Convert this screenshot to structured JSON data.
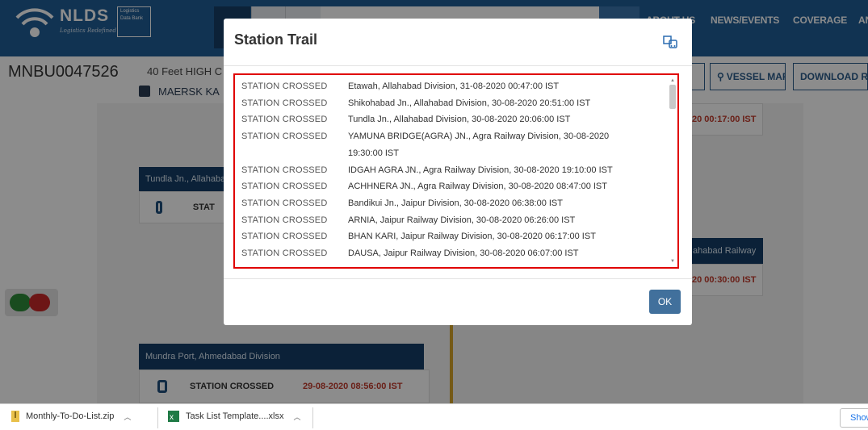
{
  "brand": {
    "name": "NLDS",
    "tagline": "Logistics Redefined",
    "sub_brand": "Logistics Data Bank"
  },
  "nav": {
    "menu": [
      "ABOUT US",
      "NEWS/EVENTS",
      "COVERAGE",
      "AN"
    ]
  },
  "container": {
    "number": "MNBU0047526",
    "type": "40 Feet HIGH C",
    "carrier": "MAERSK KA",
    "buttons": {
      "partial_left": "P",
      "vessel_map": "VESSEL MAP",
      "download": "DOWNLOAD R"
    }
  },
  "timeline": {
    "right_time_1": "20 00:17:00  IST",
    "tundla_head": "Tundla Jn., Allahaba",
    "tundla_status": "STAT",
    "right_head_2": "ahabad Railway",
    "right_time_2": "20 00:30:00  IST",
    "mundra_head": "Mundra Port, Ahmedabad Division",
    "mundra_status": "STATION CROSSED",
    "mundra_time": "29-08-2020 08:56:00  IST",
    "date_marker": "29-08-2020"
  },
  "modal": {
    "title": "Station Trail",
    "ok_label": "OK",
    "rows": [
      {
        "label": "STATION CROSSED",
        "text": "Etawah, Allahabad Division,   31-08-2020 00:47:00 IST"
      },
      {
        "label": "STATION CROSSED",
        "text": "Shikohabad Jn., Allahabad Division,   30-08-2020 20:51:00 IST"
      },
      {
        "label": "STATION CROSSED",
        "text": "Tundla Jn., Allahabad Division,   30-08-2020 20:06:00 IST"
      },
      {
        "label": "STATION CROSSED",
        "text": "YAMUNA BRIDGE(AGRA) JN., Agra Railway Division,   30-08-2020 19:30:00 IST"
      },
      {
        "label": "STATION CROSSED",
        "text": "IDGAH AGRA JN., Agra Railway Division,   30-08-2020 19:10:00 IST"
      },
      {
        "label": "STATION CROSSED",
        "text": "ACHHNERA JN., Agra Railway Division,   30-08-2020 08:47:00 IST"
      },
      {
        "label": "STATION CROSSED",
        "text": "Bandikui Jn., Jaipur Division,   30-08-2020 06:38:00 IST"
      },
      {
        "label": "STATION CROSSED",
        "text": "ARNIA, Jaipur Railway Division,   30-08-2020 06:26:00 IST"
      },
      {
        "label": "STATION CROSSED",
        "text": "BHAN KARI, Jaipur Railway Division,   30-08-2020 06:17:00 IST"
      },
      {
        "label": "STATION CROSSED",
        "text": "DAUSA, Jaipur Railway Division,   30-08-2020 06:07:00 IST"
      }
    ]
  },
  "downloads": {
    "file1": "Monthly-To-Do-List.zip",
    "file2": "Task List Template....xlsx",
    "show_all": "Show"
  },
  "colors": {
    "header_blue": "#1f5d96",
    "card_head": "#143d66",
    "highlight_red": "#e00000",
    "ok_button": "#41709c",
    "track_gold": "#d6a52a"
  }
}
